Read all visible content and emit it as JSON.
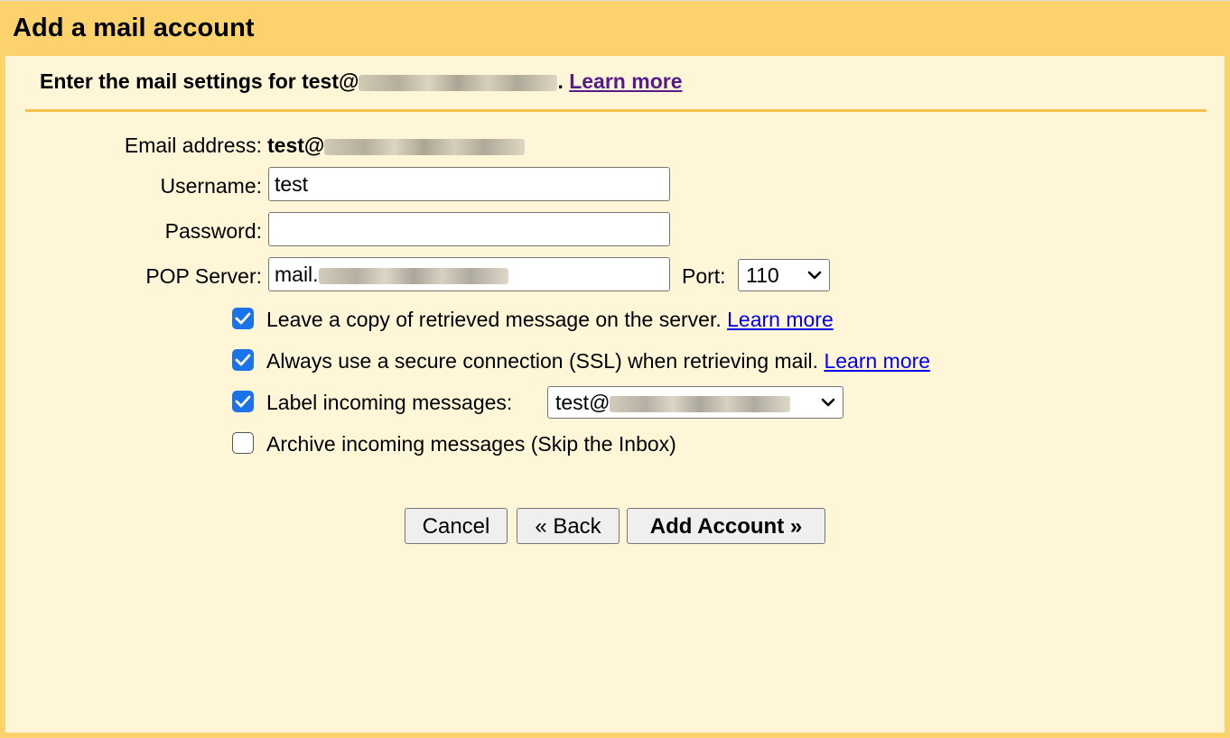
{
  "window": {
    "title": "Add a mail account"
  },
  "intro": {
    "prefix": "Enter the mail settings for test@",
    "suffix": ". ",
    "learn_more": "Learn more"
  },
  "form": {
    "email": {
      "label": "Email address:",
      "value": "test@"
    },
    "username": {
      "label": "Username:",
      "value": "test"
    },
    "password": {
      "label": "Password:",
      "value": ""
    },
    "pop_server": {
      "label": "POP Server:",
      "value": "mail."
    },
    "port": {
      "label": "Port:",
      "value": "110"
    }
  },
  "options": {
    "leave_copy": {
      "label": "Leave a copy of retrieved message on the server.",
      "link": "Learn more",
      "checked": true
    },
    "ssl": {
      "label": "Always use a secure connection (SSL) when retrieving mail.",
      "link": "Learn more",
      "checked": true
    },
    "label_incoming": {
      "label": "Label incoming messages:",
      "value": "test@",
      "checked": true
    },
    "archive": {
      "label": "Archive incoming messages (Skip the Inbox)",
      "checked": false
    }
  },
  "buttons": {
    "cancel": "Cancel",
    "back": "« Back",
    "add": "Add Account »"
  },
  "colors": {
    "header_bg": "#fcd26c",
    "panel_bg": "#fef6d6",
    "divider": "#f5c24f",
    "checkbox_accent": "#1a73e8",
    "link": "#0000ee",
    "visited_link": "#551a8b"
  },
  "icons": {
    "select_arrow": "chevron-down-icon",
    "checkbox_checked": "checkmark-icon"
  }
}
